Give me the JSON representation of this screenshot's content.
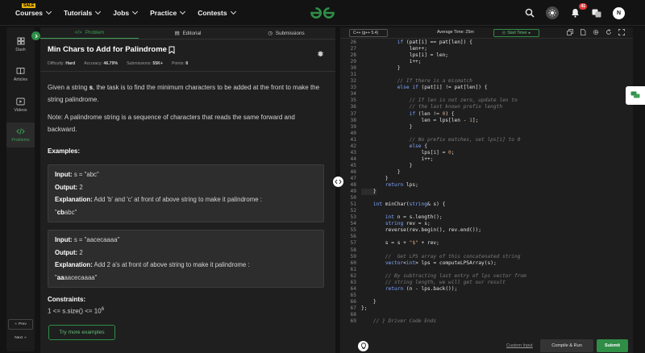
{
  "nav": {
    "items": [
      {
        "label": "Courses",
        "badge": "SALE"
      },
      {
        "label": "Tutorials"
      },
      {
        "label": "Jobs"
      },
      {
        "label": "Practice"
      },
      {
        "label": "Contests"
      }
    ],
    "notif_count": "41",
    "avatar": "N"
  },
  "sidebar": {
    "items": [
      {
        "label": "Dash"
      },
      {
        "label": "Articles"
      },
      {
        "label": "Videos"
      },
      {
        "label": "Problems"
      }
    ],
    "prev": "Prev",
    "next": "Next"
  },
  "tabs": [
    "Problem",
    "Editorial",
    "Submissions"
  ],
  "problem": {
    "title": "Min Chars to Add for Palindrome",
    "meta": {
      "difficulty_label": "Difficulty:",
      "difficulty": "Hard",
      "accuracy_label": "Accuracy:",
      "accuracy": "46.79%",
      "submissions_label": "Submissions:",
      "submissions": "55K+",
      "points_label": "Points:",
      "points": "8"
    },
    "desc_pre": "Given a string ",
    "desc_var": "s",
    "desc_post": ", the task is to find the minimum characters to be added at the front to make the string palindrome.",
    "note": "Note: A palindrome string is a sequence of characters that reads the same forward and backward.",
    "examples_title": "Examples:",
    "examples": [
      {
        "input_label": "Input:",
        "input": "s = \"abc\"",
        "output_label": "Output:",
        "output": "2",
        "expl_label": "Explanation:",
        "expl": "Add 'b' and 'c' at front of above string to make it palindrome :",
        "expl_pre": "\"",
        "expl_bold": "cb",
        "expl_post": "abc\""
      },
      {
        "input_label": "Input:",
        "input": "s = \"aacecaaaa\"",
        "output_label": "Output:",
        "output": "2",
        "expl_label": "Explanation:",
        "expl": "Add 2 a's at front of above string to make it palindrome :",
        "expl_pre": "\"",
        "expl_bold": "aa",
        "expl_post": "aacecaaaa\""
      }
    ],
    "constraints_title": "Constraints:",
    "constraint_pre": "1 <= s.size() <= 10",
    "constraint_sup": "6",
    "try_more": "Try more examples"
  },
  "editor": {
    "lang": "C++ (g++ 5.4)",
    "avg_time": "Average Time: 25m",
    "timer": "Start Timer",
    "highlight_line": "49",
    "lines": [
      [
        "26",
        "            if (pat[i] == pat[len]) {"
      ],
      [
        "27",
        "                len++;"
      ],
      [
        "28",
        "                lps[i] = len;"
      ],
      [
        "29",
        "                i++;"
      ],
      [
        "30",
        "            }"
      ],
      [
        "31",
        ""
      ],
      [
        "32",
        "            // If there is a mismatch"
      ],
      [
        "33",
        "            else if (pat[i] != pat[len]) {"
      ],
      [
        "34",
        ""
      ],
      [
        "35",
        "                // If len is not zero, update len to"
      ],
      [
        "36",
        "                // the last known prefix length"
      ],
      [
        "37",
        "                if (len != 0) {"
      ],
      [
        "38",
        "                    len = lps[len - 1];"
      ],
      [
        "39",
        "                }"
      ],
      [
        "40",
        ""
      ],
      [
        "41",
        "                // No prefix matches, set lps[i] to 0"
      ],
      [
        "42",
        "                else {"
      ],
      [
        "43",
        "                    lps[i] = 0;"
      ],
      [
        "44",
        "                    i++;"
      ],
      [
        "45",
        "                }"
      ],
      [
        "46",
        "            }"
      ],
      [
        "47",
        "        }"
      ],
      [
        "48",
        "        return lps;"
      ],
      [
        "49",
        "    }"
      ],
      [
        "50",
        ""
      ],
      [
        "51",
        "    int minChar(string& s) {"
      ],
      [
        "52",
        ""
      ],
      [
        "53",
        "        int n = s.length();"
      ],
      [
        "54",
        "        string rev = s;"
      ],
      [
        "55",
        "        reverse(rev.begin(), rev.end());"
      ],
      [
        "56",
        ""
      ],
      [
        "57",
        "        s = s + \"$\" + rev;"
      ],
      [
        "58",
        ""
      ],
      [
        "59",
        "        //  Get LPS array of this concatenated string"
      ],
      [
        "60",
        "        vector<int> lps = computeLPSArray(s);"
      ],
      [
        "61",
        ""
      ],
      [
        "62",
        "        // By subtracting last entry of lps vector from"
      ],
      [
        "63",
        "        // string length, we will get our result"
      ],
      [
        "64",
        "        return (n - lps.back());"
      ],
      [
        "65",
        ""
      ],
      [
        "66",
        "    }"
      ],
      [
        "67",
        "};"
      ],
      [
        "68",
        ""
      ],
      [
        "69",
        "    // } Driver Code Ends"
      ]
    ],
    "custom_input": "Custom Input",
    "compile": "Compile & Run",
    "submit": "Submit"
  },
  "colors": {
    "accent": "#2f8d46",
    "bg": "#131313",
    "panel": "#1f1f1f"
  }
}
